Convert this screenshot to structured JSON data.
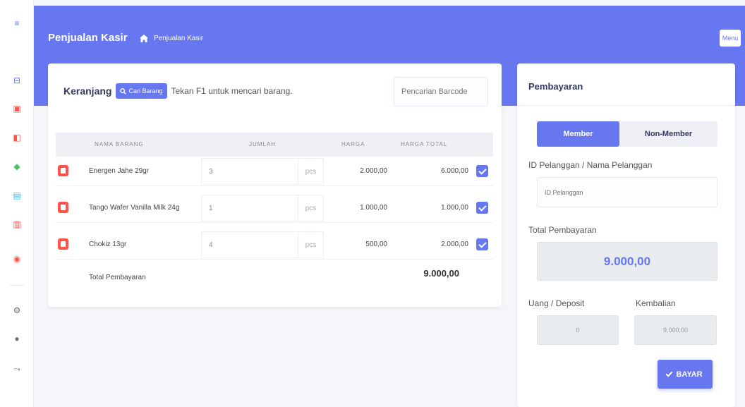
{
  "colors": {
    "primary": "#6777ef",
    "danger": "#fc544b",
    "background": "#f4f6f9"
  },
  "sidebar": {
    "icons": [
      {
        "name": "menu-toggle-icon",
        "glyph": "≡",
        "color": "#6777ef"
      },
      {
        "name": "box-icon",
        "glyph": "⊟",
        "color": "#6777ef"
      },
      {
        "name": "cart-icon",
        "glyph": "▣",
        "color": "#fc544b"
      },
      {
        "name": "document-icon",
        "glyph": "◧",
        "color": "#fc544b"
      },
      {
        "name": "bag-icon",
        "glyph": "◆",
        "color": "#47c363"
      },
      {
        "name": "list-icon",
        "glyph": "▤",
        "color": "#3abaf4"
      },
      {
        "name": "report-icon",
        "glyph": "▥",
        "color": "#fc544b"
      },
      {
        "name": "bell-icon",
        "glyph": "◉",
        "color": "#fc544b"
      },
      {
        "name": "gear-icon",
        "glyph": "⚙",
        "color": "#6c757d"
      },
      {
        "name": "user-icon",
        "glyph": "●",
        "color": "#6c757d"
      },
      {
        "name": "logout-icon",
        "glyph": "⤳",
        "color": "#6c757d"
      }
    ]
  },
  "header": {
    "title": "Penjualan Kasir",
    "breadcrumb": "Penjualan Kasir",
    "menu_label": "Menu"
  },
  "cart": {
    "title": "Keranjang",
    "find_button": "Cari Barang",
    "hint": "Tekan F1 untuk mencari barang.",
    "barcode_placeholder": "Pencarian Barcode",
    "columns": {
      "name": "NAMA BARANG",
      "qty": "JUMLAH",
      "price": "HARGA",
      "total": "HARGA TOTAL"
    },
    "items": [
      {
        "name": "Energen Jahe 29gr",
        "qty": "3",
        "unit": "pcs",
        "price": "2.000,00",
        "total": "6.000,00"
      },
      {
        "name": "Tango Wafer Vanilla Milk 24g",
        "qty": "1",
        "unit": "pcs",
        "price": "1.000,00",
        "total": "1.000,00"
      },
      {
        "name": "Chokiz 13gr",
        "qty": "4",
        "unit": "pcs",
        "price": "500,00",
        "total": "2.000,00"
      }
    ],
    "summary_label": "Total Pembayaran",
    "summary_value": "9.000,00"
  },
  "payment": {
    "title": "Pembayaran",
    "tab_member": "Member",
    "tab_non_member": "Non-Member",
    "customer_label": "ID Pelanggan / Nama Pelanggan",
    "customer_placeholder": "ID Pelanggan",
    "total_label": "Total Pembayaran",
    "total_value": "9.000,00",
    "deposit_label": "Uang / Deposit",
    "deposit_value": "0",
    "change_label": "Kembalian",
    "change_value": "9.000,00",
    "pay_button": "BAYAR"
  }
}
